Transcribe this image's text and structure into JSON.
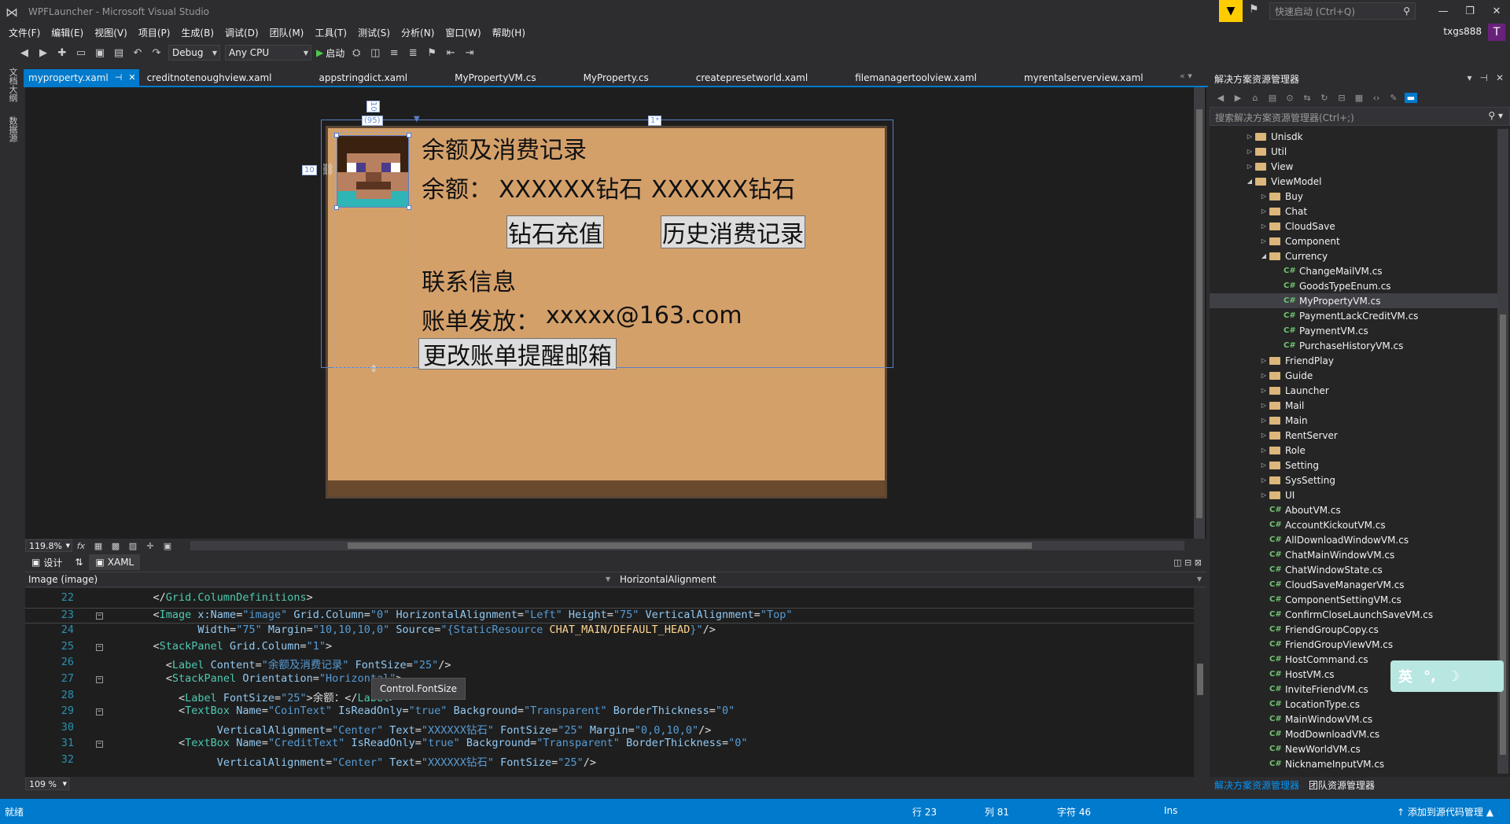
{
  "window": {
    "title": "WPFLauncher - Microsoft Visual Studio",
    "quick_launch_placeholder": "快速启动 (Ctrl+Q)",
    "account": "txgs888",
    "avatar_letter": "T"
  },
  "menu": [
    "文件(F)",
    "编辑(E)",
    "视图(V)",
    "项目(P)",
    "生成(B)",
    "调试(D)",
    "团队(M)",
    "工具(T)",
    "测试(S)",
    "分析(N)",
    "窗口(W)",
    "帮助(H)"
  ],
  "toolbar": {
    "config": "Debug",
    "platform": "Any CPU",
    "start_label": "启动"
  },
  "left_strip": [
    "文档大纲",
    "数据源"
  ],
  "doc_tabs": [
    "myproperty.xaml",
    "creditnotenoughview.xaml",
    "appstringdict.xaml",
    "MyPropertyVM.cs",
    "MyProperty.cs",
    "createpresetworld.xaml",
    "filemanagertoolview.xaml",
    "myrentalserverview.xaml"
  ],
  "designer": {
    "title_label": "余额及消费记录",
    "balance_label": "余额：",
    "coin_text": "XXXXXX钻石",
    "credit_text": "XXXXXX钻石",
    "recharge_button": "钻石充值",
    "history_button": "历史消费记录",
    "contact_label": "联系信息",
    "bill_label": "账单发放：",
    "email": "xxxxx@163.com",
    "change_email_button": "更改账单提醒邮箱",
    "ruler_top": "1*",
    "ruler_col": "(95)",
    "ruler_left": "10",
    "ruler_top_margin": "10"
  },
  "zoom": {
    "level": "119.8%",
    "fx_label": "fx"
  },
  "split_tabs": {
    "design": "设计",
    "swap": "⇅",
    "xaml": "XAML"
  },
  "navbar": {
    "element": "Image (image)",
    "property": "HorizontalAlignment"
  },
  "code": [
    {
      "ln": "22",
      "fold": false,
      "segments": [
        {
          "c": "t-txt",
          "t": "    </"
        },
        {
          "c": "t-el",
          "t": "Grid.ColumnDefinitions"
        },
        {
          "c": "t-txt",
          "t": ">"
        }
      ]
    },
    {
      "ln": "23",
      "fold": true,
      "segments": [
        {
          "c": "t-txt",
          "t": "    <"
        },
        {
          "c": "t-el",
          "t": "Image"
        },
        {
          "c": "t-attr",
          "t": " x:Name"
        },
        {
          "c": "t-txt",
          "t": "="
        },
        {
          "c": "t-blue",
          "t": "\"image\""
        },
        {
          "c": "t-attr",
          "t": " Grid.Column"
        },
        {
          "c": "t-txt",
          "t": "="
        },
        {
          "c": "t-blue",
          "t": "\"0\""
        },
        {
          "c": "t-attr",
          "t": " HorizontalAlignment"
        },
        {
          "c": "t-txt",
          "t": "="
        },
        {
          "c": "t-blue",
          "t": "\"Left\""
        },
        {
          "c": "t-attr",
          "t": " Height"
        },
        {
          "c": "t-txt",
          "t": "="
        },
        {
          "c": "t-blue",
          "t": "\"75\""
        },
        {
          "c": "t-attr",
          "t": " VerticalAlignment"
        },
        {
          "c": "t-txt",
          "t": "="
        },
        {
          "c": "t-blue",
          "t": "\"Top\""
        }
      ]
    },
    {
      "ln": "24",
      "fold": false,
      "segments": [
        {
          "c": "t-attr",
          "t": "           Width"
        },
        {
          "c": "t-txt",
          "t": "="
        },
        {
          "c": "t-blue",
          "t": "\"75\""
        },
        {
          "c": "t-attr",
          "t": " Margin"
        },
        {
          "c": "t-txt",
          "t": "="
        },
        {
          "c": "t-blue",
          "t": "\"10,10,10,0\""
        },
        {
          "c": "t-attr",
          "t": " Source"
        },
        {
          "c": "t-txt",
          "t": "="
        },
        {
          "c": "t-blue",
          "t": "\"{StaticResource "
        },
        {
          "c": "t-res",
          "t": "CHAT_MAIN/DEFAULT_HEAD"
        },
        {
          "c": "t-blue",
          "t": "}\""
        },
        {
          "c": "t-txt",
          "t": "/>"
        }
      ]
    },
    {
      "ln": "25",
      "fold": true,
      "segments": [
        {
          "c": "t-txt",
          "t": "    <"
        },
        {
          "c": "t-el",
          "t": "StackPanel"
        },
        {
          "c": "t-attr",
          "t": " Grid.Column"
        },
        {
          "c": "t-txt",
          "t": "="
        },
        {
          "c": "t-blue",
          "t": "\"1\""
        },
        {
          "c": "t-txt",
          "t": ">"
        }
      ]
    },
    {
      "ln": "26",
      "fold": false,
      "segments": [
        {
          "c": "t-txt",
          "t": "      <"
        },
        {
          "c": "t-el",
          "t": "Label"
        },
        {
          "c": "t-attr",
          "t": " Content"
        },
        {
          "c": "t-txt",
          "t": "="
        },
        {
          "c": "t-blue",
          "t": "\"余额及消费记录\""
        },
        {
          "c": "t-attr",
          "t": " FontSize"
        },
        {
          "c": "t-txt",
          "t": "="
        },
        {
          "c": "t-blue",
          "t": "\"25\""
        },
        {
          "c": "t-txt",
          "t": "/>"
        }
      ]
    },
    {
      "ln": "27",
      "fold": true,
      "segments": [
        {
          "c": "t-txt",
          "t": "      <"
        },
        {
          "c": "t-el",
          "t": "StackPanel"
        },
        {
          "c": "t-attr",
          "t": " Orientation"
        },
        {
          "c": "t-txt",
          "t": "="
        },
        {
          "c": "t-blue",
          "t": "\"Horizontal\""
        },
        {
          "c": "t-txt",
          "t": ">"
        }
      ]
    },
    {
      "ln": "28",
      "fold": false,
      "segments": [
        {
          "c": "t-txt",
          "t": "        <"
        },
        {
          "c": "t-el",
          "t": "Label"
        },
        {
          "c": "t-attr",
          "t": " FontSize"
        },
        {
          "c": "t-txt",
          "t": "="
        },
        {
          "c": "t-blue",
          "t": "\"25\""
        },
        {
          "c": "t-txt",
          "t": ">余额：</"
        },
        {
          "c": "t-el",
          "t": "Label"
        },
        {
          "c": "t-txt",
          "t": ">"
        }
      ]
    },
    {
      "ln": "29",
      "fold": true,
      "segments": [
        {
          "c": "t-txt",
          "t": "        <"
        },
        {
          "c": "t-el",
          "t": "TextBox"
        },
        {
          "c": "t-attr",
          "t": " Name"
        },
        {
          "c": "t-txt",
          "t": "="
        },
        {
          "c": "t-blue",
          "t": "\"CoinText\""
        },
        {
          "c": "t-attr",
          "t": " IsReadOnly"
        },
        {
          "c": "t-txt",
          "t": "="
        },
        {
          "c": "t-blue",
          "t": "\"true\""
        },
        {
          "c": "t-attr",
          "t": " Background"
        },
        {
          "c": "t-txt",
          "t": "="
        },
        {
          "c": "t-blue",
          "t": "\"Transparent\""
        },
        {
          "c": "t-attr",
          "t": " BorderThickness"
        },
        {
          "c": "t-txt",
          "t": "="
        },
        {
          "c": "t-blue",
          "t": "\"0\""
        }
      ]
    },
    {
      "ln": "30",
      "fold": false,
      "segments": [
        {
          "c": "t-attr",
          "t": "              VerticalAlignment"
        },
        {
          "c": "t-txt",
          "t": "="
        },
        {
          "c": "t-blue",
          "t": "\"Center\""
        },
        {
          "c": "t-attr",
          "t": " Text"
        },
        {
          "c": "t-txt",
          "t": "="
        },
        {
          "c": "t-blue",
          "t": "\"XXXXXX钻石\""
        },
        {
          "c": "t-attr",
          "t": " FontSize"
        },
        {
          "c": "t-txt",
          "t": "="
        },
        {
          "c": "t-blue",
          "t": "\"25\""
        },
        {
          "c": "t-attr",
          "t": " Margin"
        },
        {
          "c": "t-txt",
          "t": "="
        },
        {
          "c": "t-blue",
          "t": "\"0,0,10,0\""
        },
        {
          "c": "t-txt",
          "t": "/>"
        }
      ]
    },
    {
      "ln": "31",
      "fold": true,
      "segments": [
        {
          "c": "t-txt",
          "t": "        <"
        },
        {
          "c": "t-el",
          "t": "TextBox"
        },
        {
          "c": "t-attr",
          "t": " Name"
        },
        {
          "c": "t-txt",
          "t": "="
        },
        {
          "c": "t-blue",
          "t": "\"CreditText\""
        },
        {
          "c": "t-attr",
          "t": " IsReadOnly"
        },
        {
          "c": "t-txt",
          "t": "="
        },
        {
          "c": "t-blue",
          "t": "\"true\""
        },
        {
          "c": "t-attr",
          "t": " Background"
        },
        {
          "c": "t-txt",
          "t": "="
        },
        {
          "c": "t-blue",
          "t": "\"Transparent\""
        },
        {
          "c": "t-attr",
          "t": " BorderThickness"
        },
        {
          "c": "t-txt",
          "t": "="
        },
        {
          "c": "t-blue",
          "t": "\"0\""
        }
      ]
    },
    {
      "ln": "32",
      "fold": false,
      "segments": [
        {
          "c": "t-attr",
          "t": "              VerticalAlignment"
        },
        {
          "c": "t-txt",
          "t": "="
        },
        {
          "c": "t-blue",
          "t": "\"Center\""
        },
        {
          "c": "t-attr",
          "t": " Text"
        },
        {
          "c": "t-txt",
          "t": "="
        },
        {
          "c": "t-blue",
          "t": "\"XXXXXX钻石\""
        },
        {
          "c": "t-attr",
          "t": " FontSize"
        },
        {
          "c": "t-txt",
          "t": "="
        },
        {
          "c": "t-blue",
          "t": "\"25\""
        },
        {
          "c": "t-txt",
          "t": "/>"
        }
      ]
    }
  ],
  "tooltip": "Control.FontSize",
  "editor_zoom": "109 %",
  "solution": {
    "header": "解决方案资源管理器",
    "search_placeholder": "搜索解决方案资源管理器(Ctrl+;)",
    "tree": [
      {
        "label": "Unisdk",
        "depth": 0,
        "kind": "folder",
        "expanded": false
      },
      {
        "label": "Util",
        "depth": 0,
        "kind": "folder",
        "expanded": false
      },
      {
        "label": "View",
        "depth": 0,
        "kind": "folder",
        "expanded": false
      },
      {
        "label": "ViewModel",
        "depth": 0,
        "kind": "folder",
        "expanded": true
      },
      {
        "label": "Buy",
        "depth": 1,
        "kind": "folder",
        "expanded": false
      },
      {
        "label": "Chat",
        "depth": 1,
        "kind": "folder",
        "expanded": false
      },
      {
        "label": "CloudSave",
        "depth": 1,
        "kind": "folder",
        "expanded": false
      },
      {
        "label": "Component",
        "depth": 1,
        "kind": "folder",
        "expanded": false
      },
      {
        "label": "Currency",
        "depth": 1,
        "kind": "folder",
        "expanded": true
      },
      {
        "label": "ChangeMailVM.cs",
        "depth": 2,
        "kind": "cs"
      },
      {
        "label": "GoodsTypeEnum.cs",
        "depth": 2,
        "kind": "cs"
      },
      {
        "label": "MyPropertyVM.cs",
        "depth": 2,
        "kind": "cs",
        "selected": true
      },
      {
        "label": "PaymentLackCreditVM.cs",
        "depth": 2,
        "kind": "cs"
      },
      {
        "label": "PaymentVM.cs",
        "depth": 2,
        "kind": "cs"
      },
      {
        "label": "PurchaseHistoryVM.cs",
        "depth": 2,
        "kind": "cs"
      },
      {
        "label": "FriendPlay",
        "depth": 1,
        "kind": "folder",
        "expanded": false
      },
      {
        "label": "Guide",
        "depth": 1,
        "kind": "folder",
        "expanded": false
      },
      {
        "label": "Launcher",
        "depth": 1,
        "kind": "folder",
        "expanded": false
      },
      {
        "label": "Mail",
        "depth": 1,
        "kind": "folder",
        "expanded": false
      },
      {
        "label": "Main",
        "depth": 1,
        "kind": "folder",
        "expanded": false
      },
      {
        "label": "RentServer",
        "depth": 1,
        "kind": "folder",
        "expanded": false
      },
      {
        "label": "Role",
        "depth": 1,
        "kind": "folder",
        "expanded": false
      },
      {
        "label": "Setting",
        "depth": 1,
        "kind": "folder",
        "expanded": false
      },
      {
        "label": "SysSetting",
        "depth": 1,
        "kind": "folder",
        "expanded": false
      },
      {
        "label": "UI",
        "depth": 1,
        "kind": "folder",
        "expanded": false
      },
      {
        "label": "AboutVM.cs",
        "depth": 1,
        "kind": "cs"
      },
      {
        "label": "AccountKickoutVM.cs",
        "depth": 1,
        "kind": "cs"
      },
      {
        "label": "AllDownloadWindowVM.cs",
        "depth": 1,
        "kind": "cs"
      },
      {
        "label": "ChatMainWindowVM.cs",
        "depth": 1,
        "kind": "cs"
      },
      {
        "label": "ChatWindowState.cs",
        "depth": 1,
        "kind": "cs"
      },
      {
        "label": "CloudSaveManagerVM.cs",
        "depth": 1,
        "kind": "cs"
      },
      {
        "label": "ComponentSettingVM.cs",
        "depth": 1,
        "kind": "cs"
      },
      {
        "label": "ConfirmCloseLaunchSaveVM.cs",
        "depth": 1,
        "kind": "cs"
      },
      {
        "label": "FriendGroupCopy.cs",
        "depth": 1,
        "kind": "cs"
      },
      {
        "label": "FriendGroupViewVM.cs",
        "depth": 1,
        "kind": "cs"
      },
      {
        "label": "HostCommand.cs",
        "depth": 1,
        "kind": "cs"
      },
      {
        "label": "HostVM.cs",
        "depth": 1,
        "kind": "cs"
      },
      {
        "label": "InviteFriendVM.cs",
        "depth": 1,
        "kind": "cs"
      },
      {
        "label": "LocationType.cs",
        "depth": 1,
        "kind": "cs"
      },
      {
        "label": "MainWindowVM.cs",
        "depth": 1,
        "kind": "cs"
      },
      {
        "label": "ModDownloadVM.cs",
        "depth": 1,
        "kind": "cs"
      },
      {
        "label": "NewWorldVM.cs",
        "depth": 1,
        "kind": "cs"
      },
      {
        "label": "NicknameInputVM.cs",
        "depth": 1,
        "kind": "cs"
      }
    ],
    "bottom_tabs": [
      "解决方案资源管理器",
      "团队资源管理器"
    ]
  },
  "ime": {
    "lang": "英",
    "punct": "°,",
    "moon": "☽"
  },
  "status": {
    "ready": "就绪",
    "row": "行 23",
    "col": "列 81",
    "char": "字符 46",
    "ins": "Ins",
    "source_control": "添加到源代码管理"
  },
  "colors": {
    "accent": "#007acc",
    "background": "#2d2d30",
    "editor_bg": "#1e1e1e",
    "card_bg": "#d4a06a"
  }
}
